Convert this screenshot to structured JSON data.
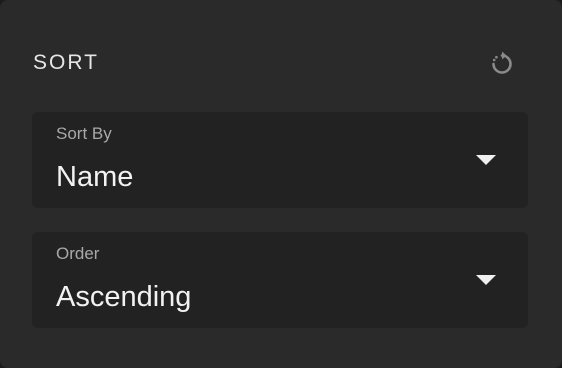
{
  "panel": {
    "title": "SORT",
    "reset_icon": "reset-icon"
  },
  "fields": [
    {
      "label": "Sort By",
      "value": "Name",
      "icon": "chevron-down-icon"
    },
    {
      "label": "Order",
      "value": "Ascending",
      "icon": "chevron-down-icon"
    }
  ],
  "colors": {
    "panel_bg": "#2a2a2a",
    "field_bg": "#222222",
    "label": "#a8a8a8",
    "value": "#f2f2f2"
  }
}
